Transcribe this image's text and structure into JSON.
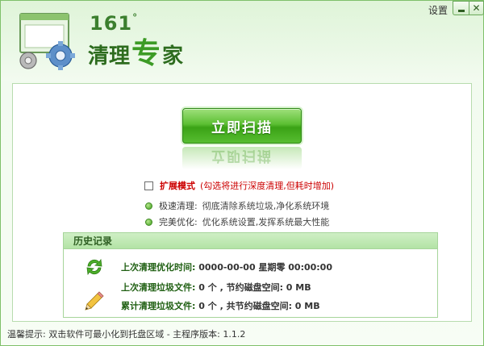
{
  "app": {
    "brand_number": "161",
    "brand_degree": "°",
    "brand_name_part1": "清理",
    "brand_name_part2": "专",
    "brand_name_part3": "家"
  },
  "titlebar": {
    "settings_label": "设置",
    "minimize_icon": "minimize-icon",
    "close_label": "✕"
  },
  "scan": {
    "button_label": "立即扫描"
  },
  "extended_mode": {
    "label": "扩展模式",
    "note": "(勾选将进行深度清理,但耗时增加)",
    "checked": false
  },
  "modes": [
    {
      "name": "极速清理:",
      "desc": "彻底清除系统垃圾,净化系统环境"
    },
    {
      "name": "完美优化:",
      "desc": "优化系统设置,发挥系统最大性能"
    }
  ],
  "history": {
    "title": "历史记录",
    "last_clean_time_label": "上次清理优化时间:",
    "last_clean_time_value": "0000-00-00 星期零 00:00:00",
    "last_files_label": "上次清理垃圾文件:",
    "last_files_value": "0 个 , 节约磁盘空间: 0 MB",
    "total_files_label": "累计清理垃圾文件:",
    "total_files_value": "0 个 , 共节约磁盘空间: 0 MB"
  },
  "status_bar": {
    "tip": "温馨提示: 双击软件可最小化到托盘区域 - 主程序版本: 1.1.2"
  },
  "colors": {
    "accent": "#3aa215",
    "brand_dark": "#2d6c1e",
    "warning": "#cc0000"
  }
}
